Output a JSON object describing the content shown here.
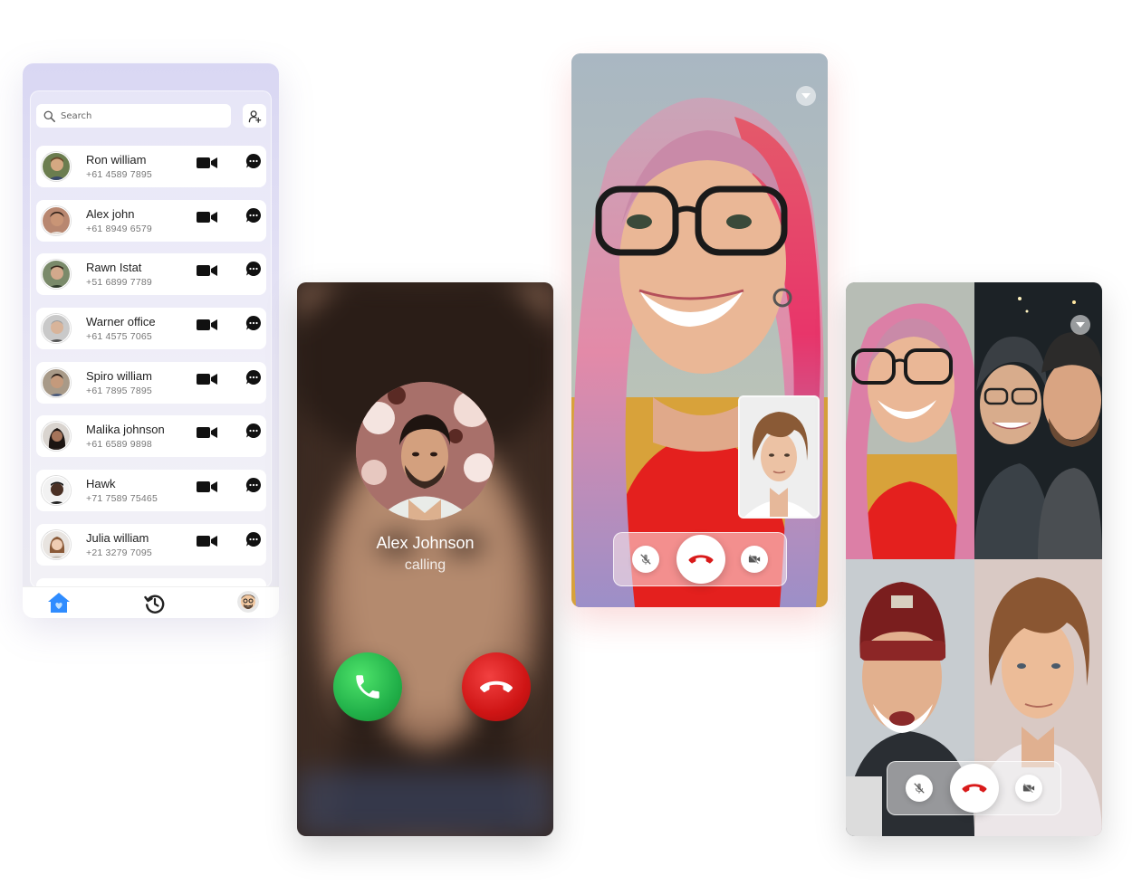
{
  "search": {
    "placeholder": "Search"
  },
  "contacts": [
    {
      "name": "Ron william",
      "phone": "+61 4589 7895"
    },
    {
      "name": "Alex john",
      "phone": "+61 8949 6579"
    },
    {
      "name": "Rawn Istat",
      "phone": "+51 6899 7789"
    },
    {
      "name": "Warner office",
      "phone": "+61 4575 7065"
    },
    {
      "name": "Spiro william",
      "phone": "+61 7895 7895"
    },
    {
      "name": "Malika johnson",
      "phone": "+61 6589 9898"
    },
    {
      "name": "Hawk",
      "phone": "+71 7589 75465"
    },
    {
      "name": "Julia william",
      "phone": "+21 3279 7095"
    }
  ],
  "incoming_call": {
    "caller_name": "Alex Johnson",
    "status": "calling"
  },
  "colors": {
    "accept": "#22b14a",
    "decline": "#cf1515",
    "nav_active": "#2f8cff",
    "panel_tint": "#d9d7f3"
  },
  "icons": {
    "search": "search-icon",
    "add_contact": "add-user-icon",
    "video": "video-camera-icon",
    "chat": "chat-bubble-icon",
    "home": "home-heart-icon",
    "history": "history-icon",
    "accept": "phone-icon",
    "decline": "phone-hangup-icon",
    "mute": "mic-off-icon",
    "camera_off": "video-off-icon",
    "collapse": "chevron-down-icon"
  }
}
